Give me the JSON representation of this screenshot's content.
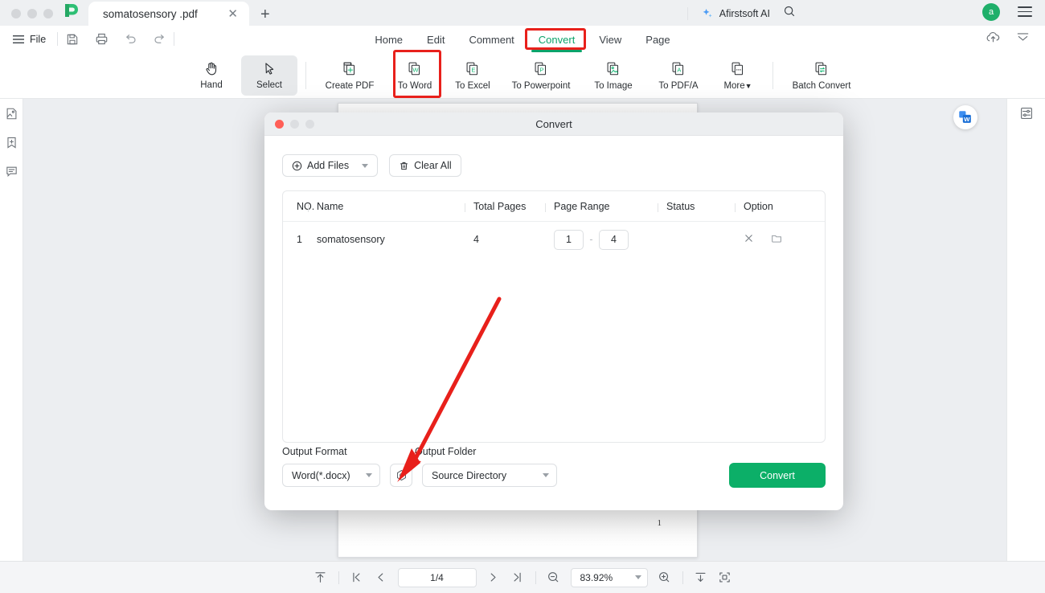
{
  "titlebar": {
    "logo_icon": "afirstsoft-logo",
    "tab": {
      "title": "somatosensory .pdf",
      "close_icon": "close-icon"
    },
    "new_tab_label": "+",
    "avatar_letter": "a",
    "menu_icon": "hamburger-menu-icon"
  },
  "filebar": {
    "file_label": "File",
    "icons": [
      "save-icon",
      "print-icon",
      "undo-icon",
      "redo-icon"
    ]
  },
  "menu": {
    "items": [
      {
        "label": "Home",
        "active": false
      },
      {
        "label": "Edit",
        "active": false
      },
      {
        "label": "Comment",
        "active": false
      },
      {
        "label": "Convert",
        "active": true
      },
      {
        "label": "View",
        "active": false
      },
      {
        "label": "Page",
        "active": false
      }
    ],
    "ai_label": "Afirstsoft AI",
    "ai_icon": "sparkle-icon",
    "search_icon": "search-icon",
    "cloud_upload_icon": "cloud-upload-icon",
    "collapse_icon": "collapse-ribbon-icon",
    "active_color": "#0ca36a",
    "highlight_color": "#e8201b"
  },
  "ribbon": {
    "tools": [
      {
        "label": "Hand",
        "icon": "hand-icon",
        "selected": false
      },
      {
        "label": "Select",
        "icon": "cursor-icon",
        "selected": true
      }
    ],
    "actions": [
      {
        "label": "Create PDF",
        "icon": "create-pdf-icon",
        "glyph": "+"
      },
      {
        "label": "To Word",
        "icon": "to-word-icon",
        "glyph": "W"
      },
      {
        "label": "To Excel",
        "icon": "to-excel-icon",
        "glyph": "E"
      },
      {
        "label": "To Powerpoint",
        "icon": "to-powerpoint-icon",
        "glyph": "P"
      },
      {
        "label": "To Image",
        "icon": "to-image-icon",
        "glyph": ""
      },
      {
        "label": "To PDF/A",
        "icon": "to-pdfa-icon",
        "glyph": "A"
      },
      {
        "label": "More",
        "icon": "more-icon",
        "glyph": ""
      }
    ],
    "batch": {
      "label": "Batch Convert",
      "icon": "batch-convert-icon"
    }
  },
  "leftrail": {
    "items": [
      {
        "icon": "thumbnail-icon",
        "name": "thumbnails-panel"
      },
      {
        "icon": "bookmark-icon",
        "name": "bookmarks-panel"
      },
      {
        "icon": "comment-icon",
        "name": "comments-panel"
      }
    ]
  },
  "rightrail": {
    "items": [
      {
        "icon": "properties-icon",
        "name": "properties-panel"
      }
    ]
  },
  "document": {
    "page_number": "1",
    "float_button_icon": "word-convert-icon"
  },
  "dialog": {
    "title": "Convert",
    "traffic": [
      "#ff5f57",
      "#dcdee1",
      "#dcdee1"
    ],
    "toolbar": {
      "add_files_label": "Add Files",
      "add_files_icon": "plus-circle-icon",
      "add_files_caret_icon": "chevron-down-icon",
      "clear_all_label": "Clear All",
      "clear_all_icon": "trash-icon"
    },
    "table": {
      "columns": [
        "NO.",
        "Name",
        "Total Pages",
        "Page Range",
        "Status",
        "Option"
      ],
      "rows": [
        {
          "no": "1",
          "name": "somatosensory",
          "total_pages": "4",
          "range_from": "1",
          "range_to": "4",
          "range_separator": "-",
          "status": "",
          "remove_icon": "close-icon",
          "folder_icon": "folder-icon"
        }
      ]
    },
    "footer": {
      "output_format_label": "Output Format",
      "output_format_value": "Word(*.docx)",
      "output_folder_label": "Output Folder",
      "output_folder_value": "Source Directory",
      "settings_icon": "settings-gear-icon",
      "convert_label": "Convert",
      "convert_color": "#0caf68"
    }
  },
  "statusbar": {
    "fit_top_icon": "scroll-top-icon",
    "first_page_icon": "first-page-icon",
    "prev_page_icon": "prev-page-icon",
    "page_value": "1/4",
    "next_page_icon": "next-page-icon",
    "last_page_icon": "last-page-icon",
    "zoom_out_icon": "zoom-out-icon",
    "zoom_value": "83.92%",
    "zoom_caret_icon": "chevron-down-icon",
    "zoom_in_icon": "zoom-in-icon",
    "fit_width_icon": "fit-width-icon",
    "fit_page_icon": "fit-page-icon"
  }
}
